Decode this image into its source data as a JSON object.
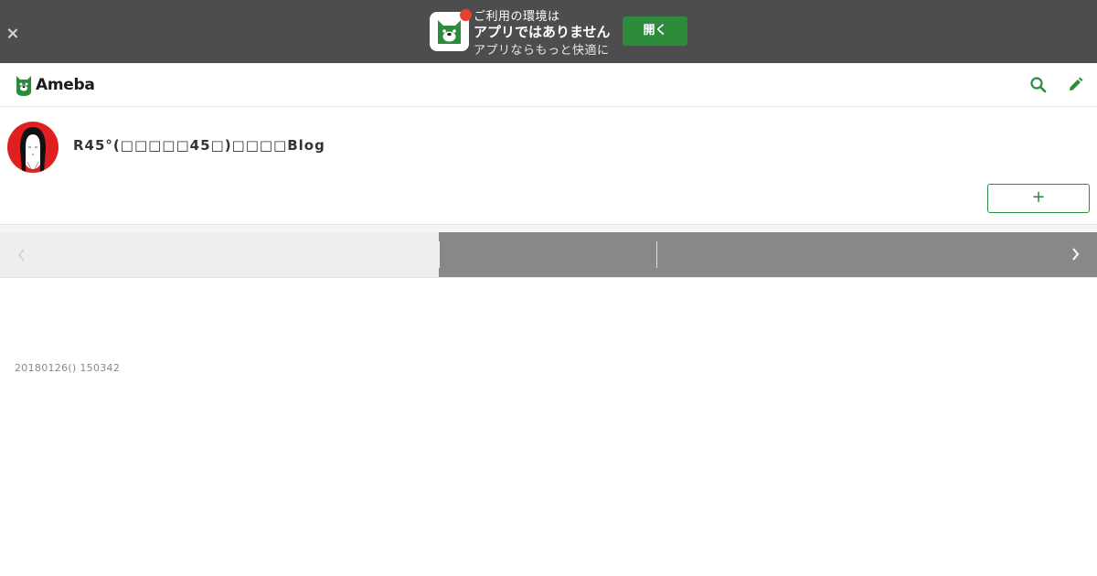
{
  "app_banner": {
    "line1": "ご利用の環境は",
    "line2": "アプリではありません",
    "line3": "アプリならもっと快適に",
    "open_label": "開く",
    "icon": "ameba-app-icon",
    "accent": "#2d8c3c",
    "dot_color": "#e8422f"
  },
  "header": {
    "logo_text": "Ameba",
    "icons": [
      "search-icon",
      "pencil-icon"
    ],
    "brand_color": "#2d8c3c"
  },
  "profile": {
    "blog_title": "R45°(□□□□□45□)□□□□Blog",
    "follow_label": "+",
    "avatar_bg": "#e02020"
  },
  "pager": {
    "prev_icon": "chevron-left-icon",
    "next_icon": "chevron-right-icon"
  },
  "entry": {
    "date": "20180126() 150342"
  }
}
